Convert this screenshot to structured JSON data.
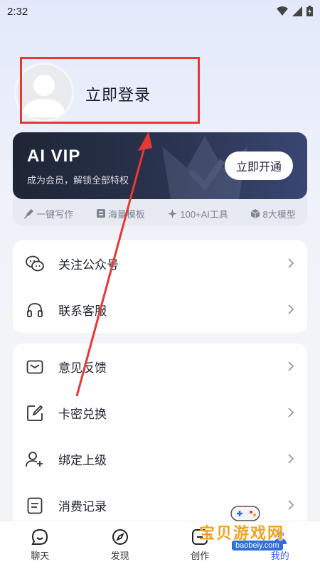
{
  "status": {
    "time": "2:32"
  },
  "profile": {
    "login_label": "立即登录"
  },
  "vip": {
    "title": "AI VIP",
    "subtitle": "成为会员，解锁全部特权",
    "button_label": "立即开通",
    "features": [
      {
        "icon": "pen-icon",
        "label": "一键写作"
      },
      {
        "icon": "template-icon",
        "label": "海量模板"
      },
      {
        "icon": "sparkle-icon",
        "label": "100+AI工具"
      },
      {
        "icon": "cube-icon",
        "label": "8大模型"
      }
    ]
  },
  "menu_group_1": [
    {
      "icon": "wechat-icon",
      "label": "关注公众号"
    },
    {
      "icon": "headset-icon",
      "label": "联系客服"
    }
  ],
  "menu_group_2": [
    {
      "icon": "mail-icon",
      "label": "意见反馈"
    },
    {
      "icon": "edit-icon",
      "label": "卡密兑换"
    },
    {
      "icon": "add-user-icon",
      "label": "绑定上级"
    },
    {
      "icon": "receipt-icon",
      "label": "消费记录"
    }
  ],
  "tabs": [
    {
      "icon": "chat-icon",
      "label": "聊天"
    },
    {
      "icon": "compass-icon",
      "label": "发现"
    },
    {
      "icon": "create-icon",
      "label": "创作"
    },
    {
      "icon": "user-icon",
      "label": "我的"
    }
  ],
  "watermark": {
    "text": "宝贝游戏网",
    "url": "baobeiy.com"
  },
  "colors": {
    "accent": "#3b63f0",
    "annotation": "#e53935",
    "vip_bg": "#2b3450"
  }
}
